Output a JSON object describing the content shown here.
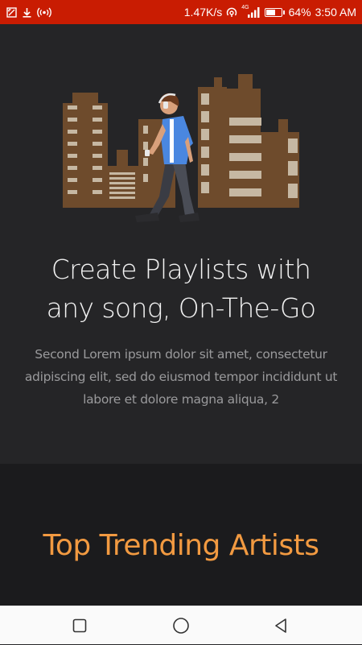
{
  "status_bar": {
    "network_speed": "1.47K/s",
    "network_type": "4G",
    "battery_percent": "64%",
    "battery_level": 0.64,
    "time": "3:50 AM",
    "icons": [
      "screenshot-icon",
      "download-icon",
      "hotspot-icon",
      "data-sync-icon",
      "signal-icon",
      "battery-icon"
    ]
  },
  "hero": {
    "illustration": "city-skyline-walking-person-with-headphones",
    "headline_line1": "Create Playlists with",
    "headline_line2": "any song, On-The-Go",
    "body": "Second Lorem ipsum dolor sit amet, consectetur adipiscing elit, sed do eiusmod tempor incididunt ut labore et dolore magna aliqua, 2"
  },
  "trending": {
    "title": "Top Trending Artists"
  },
  "nav_bar": {
    "icons": [
      "recent-apps-icon",
      "home-icon",
      "back-icon"
    ]
  },
  "colors": {
    "status_bar": "#c91c02",
    "background": "#252527",
    "section_background": "#1b1b1d",
    "accent": "#f29a41",
    "building": "#6e4b2c",
    "window": "#c6b8a3",
    "shirt": "#4a87e0"
  }
}
